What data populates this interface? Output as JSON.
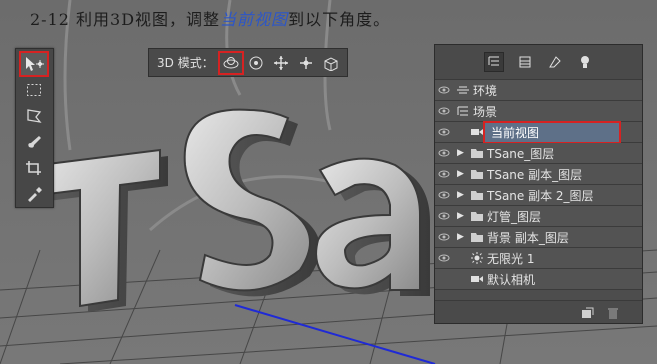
{
  "caption": {
    "prefix": "2-12 利用3D视图，调整",
    "highlight": "当前视图",
    "suffix": "到以下角度。"
  },
  "toolbar": {
    "tools": [
      {
        "name": "move-3d-tool",
        "icon": "move-arrow-icon",
        "active": true
      },
      {
        "name": "marquee-tool",
        "icon": "marquee-icon",
        "active": false
      },
      {
        "name": "lasso-tool",
        "icon": "lasso-icon",
        "active": false
      },
      {
        "name": "brush-tool",
        "icon": "brush-icon",
        "active": false
      },
      {
        "name": "crop-tool",
        "icon": "crop-icon",
        "active": false
      },
      {
        "name": "eyedropper-tool",
        "icon": "eyedropper-icon",
        "active": false
      }
    ]
  },
  "mode_bar": {
    "label": "3D 模式：",
    "modes": [
      {
        "name": "orbit-mode",
        "icon": "orbit-icon",
        "active": true
      },
      {
        "name": "roll-mode",
        "icon": "roll-icon",
        "active": false
      },
      {
        "name": "pan-mode",
        "icon": "pan-icon",
        "active": false
      },
      {
        "name": "slide-mode",
        "icon": "slide-icon",
        "active": false
      },
      {
        "name": "scale-mode",
        "icon": "scale-icon",
        "active": false
      }
    ]
  },
  "panel": {
    "tabs": [
      {
        "name": "scene-tab",
        "icon": "scene-filter-icon",
        "active": true
      },
      {
        "name": "mesh-tab",
        "icon": "mesh-icon",
        "active": false
      },
      {
        "name": "material-tab",
        "icon": "material-icon",
        "active": false
      },
      {
        "name": "light-tab",
        "icon": "light-bulb-icon",
        "active": false
      }
    ],
    "rows": [
      {
        "label": "环境",
        "icon": "environment-icon",
        "indent": 0,
        "expand": false,
        "eye": true,
        "selected": false
      },
      {
        "label": "场景",
        "icon": "scene-icon",
        "indent": 0,
        "expand": false,
        "eye": true,
        "selected": false
      },
      {
        "label": "当前视图",
        "icon": "camera-icon",
        "indent": 1,
        "expand": false,
        "eye": true,
        "selected": true
      },
      {
        "label": "TSane_图层",
        "icon": "folder-icon",
        "indent": 1,
        "expand": true,
        "eye": true,
        "selected": false
      },
      {
        "label": "TSane 副本_图层",
        "icon": "folder-icon",
        "indent": 1,
        "expand": true,
        "eye": true,
        "selected": false
      },
      {
        "label": "TSane 副本 2_图层",
        "icon": "folder-icon",
        "indent": 1,
        "expand": true,
        "eye": true,
        "selected": false
      },
      {
        "label": "灯管_图层",
        "icon": "folder-icon",
        "indent": 1,
        "expand": true,
        "eye": true,
        "selected": false
      },
      {
        "label": "背景 副本_图层",
        "icon": "folder-icon",
        "indent": 1,
        "expand": true,
        "eye": true,
        "selected": false
      },
      {
        "label": "无限光 1",
        "icon": "infinite-light-icon",
        "indent": 1,
        "expand": false,
        "eye": true,
        "selected": false
      },
      {
        "label": "默认相机",
        "icon": "camera-icon",
        "indent": 1,
        "expand": false,
        "eye": false,
        "selected": false
      }
    ],
    "footer": [
      {
        "name": "new-light-button",
        "icon": "new-item-icon"
      },
      {
        "name": "delete-button",
        "icon": "trash-icon"
      }
    ]
  },
  "viewport": {
    "text": "TSa"
  },
  "colors": {
    "highlight_red": "#d62222",
    "caption_blue": "#2c56c8",
    "panel_bg": "#4d4d4d",
    "selected_row": "#5e7088",
    "ground_axis": "#1f2ad6"
  }
}
